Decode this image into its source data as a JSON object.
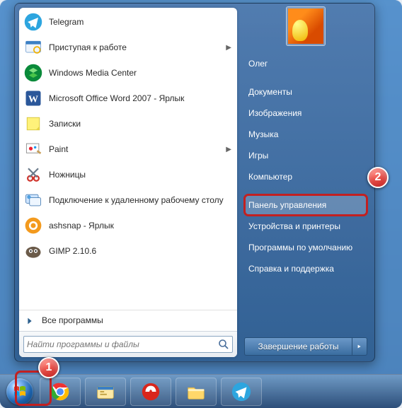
{
  "left_programs": [
    {
      "label": "Telegram",
      "icon": "telegram-icon",
      "has_sub": false
    },
    {
      "label": "Приступая к работе",
      "icon": "getting-started-icon",
      "has_sub": true
    },
    {
      "label": "Windows Media Center",
      "icon": "wmc-icon",
      "has_sub": false
    },
    {
      "label": "Microsoft Office Word 2007 - Ярлык",
      "icon": "word-icon",
      "has_sub": false
    },
    {
      "label": "Записки",
      "icon": "sticky-notes-icon",
      "has_sub": false
    },
    {
      "label": "Paint",
      "icon": "paint-icon",
      "has_sub": true
    },
    {
      "label": "Ножницы",
      "icon": "snipping-icon",
      "has_sub": false
    },
    {
      "label": "Подключение к удаленному рабочему столу",
      "icon": "rdp-icon",
      "has_sub": false
    },
    {
      "label": "ashsnap - Ярлык",
      "icon": "ashsnap-icon",
      "has_sub": false
    },
    {
      "label": "GIMP 2.10.6",
      "icon": "gimp-icon",
      "has_sub": false
    }
  ],
  "all_programs_label": "Все программы",
  "search_placeholder": "Найти программы и файлы",
  "right_items": [
    "Олег",
    "Документы",
    "Изображения",
    "Музыка",
    "Игры",
    "Компьютер",
    "Панель управления",
    "Устройства и принтеры",
    "Программы по умолчанию",
    "Справка и поддержка"
  ],
  "highlight_right_index": 6,
  "shutdown_label": "Завершение работы",
  "taskbar_items": [
    "chrome-icon",
    "explorer-icon",
    "garena-icon",
    "folder-icon",
    "telegram-icon"
  ],
  "callouts": {
    "1": "1",
    "2": "2"
  }
}
